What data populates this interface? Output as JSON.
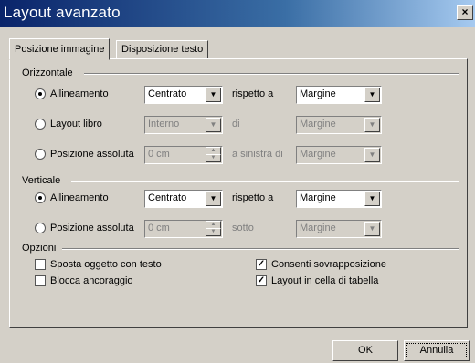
{
  "window": {
    "title": "Layout avanzato",
    "close": "×"
  },
  "tabs": [
    {
      "label": "Posizione immagine",
      "active": true
    },
    {
      "label": "Disposizione testo",
      "active": false
    }
  ],
  "horizontal": {
    "label": "Orizzontale",
    "alignment": {
      "label": "Allineamento",
      "value": "Centrato",
      "relative_label": "rispetto a",
      "relative_value": "Margine",
      "selected": true
    },
    "book_layout": {
      "label": "Layout libro",
      "value": "Interno",
      "relative_label": "di",
      "relative_value": "Margine"
    },
    "absolute": {
      "label": "Posizione assoluta",
      "value": "0 cm",
      "relative_label": "a sinistra di",
      "relative_value": "Margine"
    }
  },
  "vertical": {
    "label": "Verticale",
    "alignment": {
      "label": "Allineamento",
      "value": "Centrato",
      "relative_label": "rispetto a",
      "relative_value": "Margine",
      "selected": true
    },
    "absolute": {
      "label": "Posizione assoluta",
      "value": "0 cm",
      "relative_label": "sotto",
      "relative_value": "Margine"
    }
  },
  "options": {
    "label": "Opzioni",
    "move_with_text": {
      "label": "Sposta oggetto con testo",
      "checked": false
    },
    "lock_anchor": {
      "label": "Blocca ancoraggio",
      "checked": false
    },
    "allow_overlap": {
      "label": "Consenti sovrapposizione",
      "checked": true
    },
    "layout_in_cell": {
      "label": "Layout in cella di tabella",
      "checked": true
    }
  },
  "buttons": {
    "ok": "OK",
    "cancel": "Annulla"
  }
}
